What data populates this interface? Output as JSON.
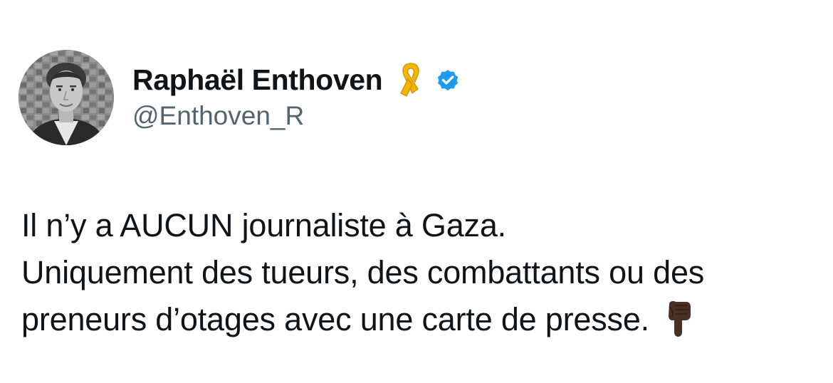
{
  "tweet": {
    "author": {
      "display_name": "Raphaël Enthoven",
      "handle": "@Enthoven_R",
      "avatar_icon": "profile-photo",
      "badges": [
        "yellow-ribbon-emoji",
        "verified-badge-icon"
      ],
      "verified_color": "#1d9bf0",
      "ribbon_color": "#f5b800"
    },
    "text_lines": [
      "Il n’y a AUCUN journaliste à Gaza.",
      "Uniquement des tueurs, des combattants ou des",
      "preneurs d’otages avec une carte de presse."
    ],
    "trailing_emoji": "backhand-index-pointing-down-dark-skin-tone"
  }
}
